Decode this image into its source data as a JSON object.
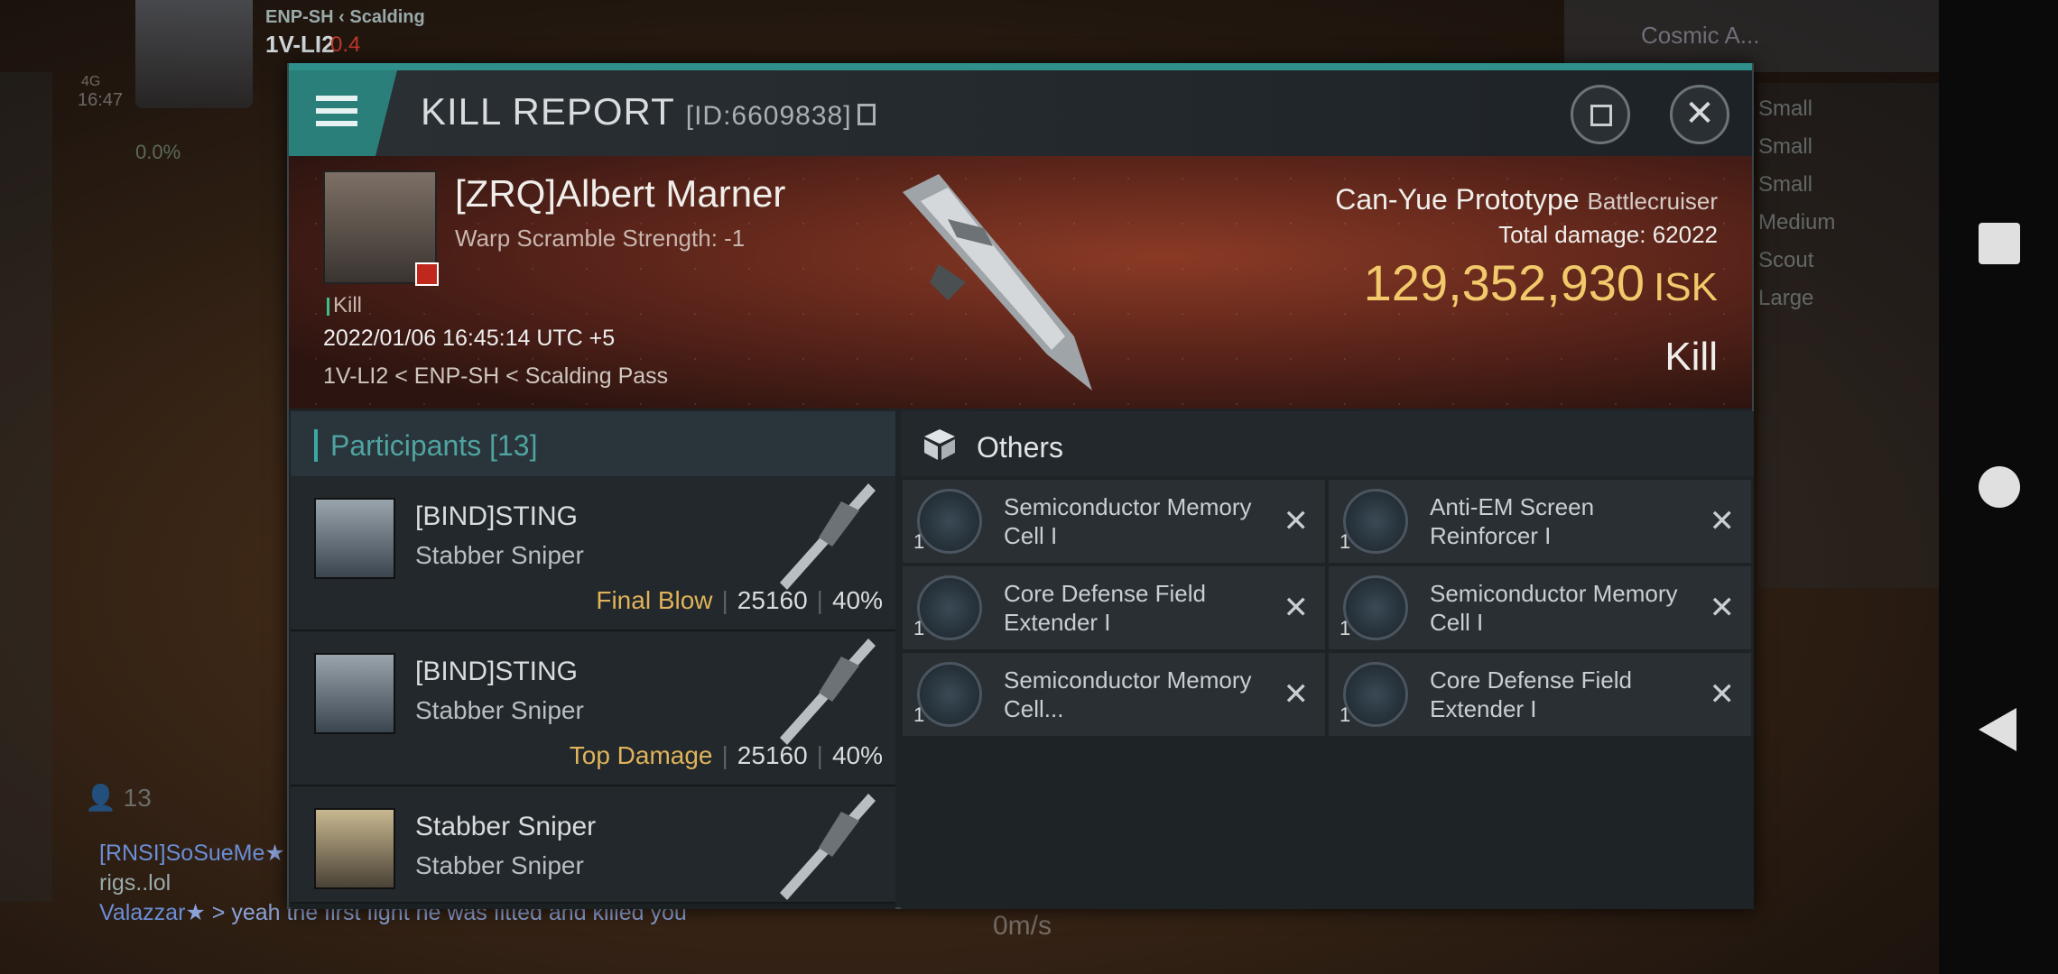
{
  "hud": {
    "corp": "ENP-SH",
    "region": "Scalding",
    "system": "1V-LI2",
    "security": "0.4",
    "percent": "0.0%",
    "network": "4G",
    "time": "16:47",
    "filter_label": "Cosmic A...",
    "right_list": [
      "Small",
      "Small",
      "Small",
      "Medium",
      "Scout",
      "Large"
    ],
    "people_count": "13",
    "speed": "0m/s",
    "chat": [
      {
        "name": "[RNSI]SoSueMe",
        "text": "rigs..lol"
      },
      {
        "name": "Valazzar",
        "text": "> yeah the first fight he was fitted and killed you"
      }
    ]
  },
  "report": {
    "title": "KILL REPORT",
    "id": "[ID:6609838]",
    "victim_name": "[ZRQ]Albert Marner",
    "warp_scramble": "Warp Scramble Strength: -1",
    "kill_tag": "Kill",
    "timestamp": "2022/01/06 16:45:14 UTC +5",
    "location": "1V-LI2 < ENP-SH < Scalding Pass",
    "ship_name": "Can-Yue Prototype",
    "ship_class": "Battlecruiser",
    "total_damage_label": "Total damage:",
    "total_damage": "62022",
    "isk_value": "129,352,930",
    "isk_unit": "ISK",
    "result": "Kill"
  },
  "participants": {
    "header": "Participants [13]",
    "rows": [
      {
        "name": "[BIND]STING",
        "ship": "Stabber Sniper",
        "label": "Final Blow",
        "damage": "25160",
        "percent": "40%"
      },
      {
        "name": "[BIND]STING",
        "ship": "Stabber Sniper",
        "label": "Top Damage",
        "damage": "25160",
        "percent": "40%"
      },
      {
        "name": "Stabber Sniper",
        "ship": "Stabber Sniper",
        "label": "",
        "damage": "",
        "percent": ""
      }
    ]
  },
  "others": {
    "header": "Others",
    "items": [
      {
        "qty": "1",
        "name": "Semiconductor Memory Cell I",
        "icon": "memory-cell-icon"
      },
      {
        "qty": "1",
        "name": "Anti-EM Screen Reinforcer I",
        "icon": "shield-reinforcer-icon"
      },
      {
        "qty": "1",
        "name": "Core Defense Field Extender I",
        "icon": "shield-extender-icon"
      },
      {
        "qty": "1",
        "name": "Semiconductor Memory Cell I",
        "icon": "memory-cell-icon"
      },
      {
        "qty": "1",
        "name": "Semiconductor Memory Cell...",
        "icon": "memory-cell-icon"
      },
      {
        "qty": "1",
        "name": "Core Defense Field Extender I",
        "icon": "shield-extender-icon"
      }
    ]
  },
  "colors": {
    "accent": "#2f8f8a",
    "isk": "#f2c96a",
    "final_blow": "#e0b35a",
    "security": "#c0392b"
  }
}
